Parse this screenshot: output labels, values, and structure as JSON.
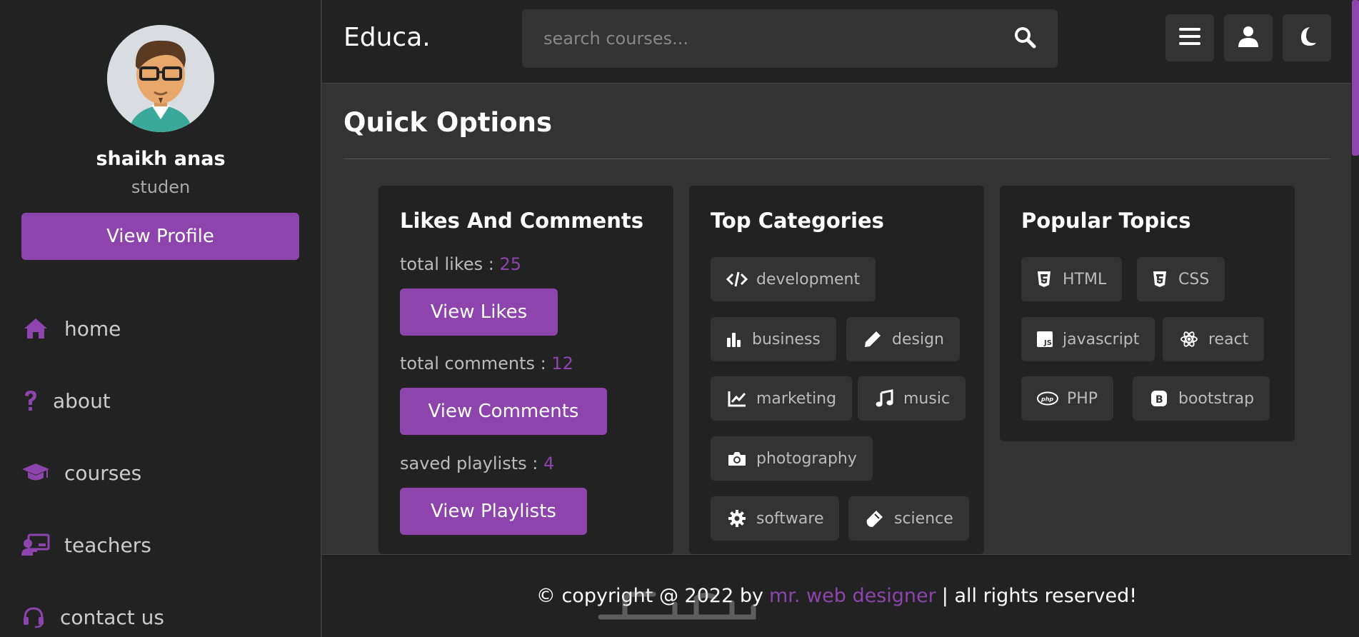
{
  "colors": {
    "accent": "#8e44ad",
    "panel": "#222222",
    "background": "#333333"
  },
  "header": {
    "logo": "Educa.",
    "search_placeholder": "search courses...",
    "icons": [
      "search-icon",
      "menu-icon",
      "user-icon",
      "moon-icon"
    ]
  },
  "sidebar": {
    "name": "shaikh anas",
    "role": "studen",
    "view_profile": "View Profile",
    "items": [
      {
        "label": "home",
        "icon": "home-icon"
      },
      {
        "label": "about",
        "icon": "question-icon"
      },
      {
        "label": "courses",
        "icon": "graduation-cap-icon"
      },
      {
        "label": "teachers",
        "icon": "teacher-icon"
      },
      {
        "label": "contact us",
        "icon": "headset-icon"
      }
    ]
  },
  "main": {
    "title": "Quick Options",
    "likes_card": {
      "title": "Likes And Comments",
      "likes_label": "total likes : ",
      "likes_value": "25",
      "likes_button": "View Likes",
      "comments_label": "total comments : ",
      "comments_value": "12",
      "comments_button": "View Comments",
      "playlists_label": "saved playlists : ",
      "playlists_value": "4",
      "playlists_button": "View Playlists"
    },
    "categories_card": {
      "title": "Top Categories",
      "items": [
        "development",
        "business",
        "design",
        "marketing",
        "music",
        "photography",
        "software",
        "science"
      ]
    },
    "topics_card": {
      "title": "Popular Topics",
      "items": [
        "HTML",
        "CSS",
        "javascript",
        "react",
        "PHP",
        "bootstrap"
      ]
    }
  },
  "footer": {
    "prefix": "© copyright @ 2022 by",
    "link": "mr. web designer",
    "suffix": "| all rights reserved!"
  }
}
